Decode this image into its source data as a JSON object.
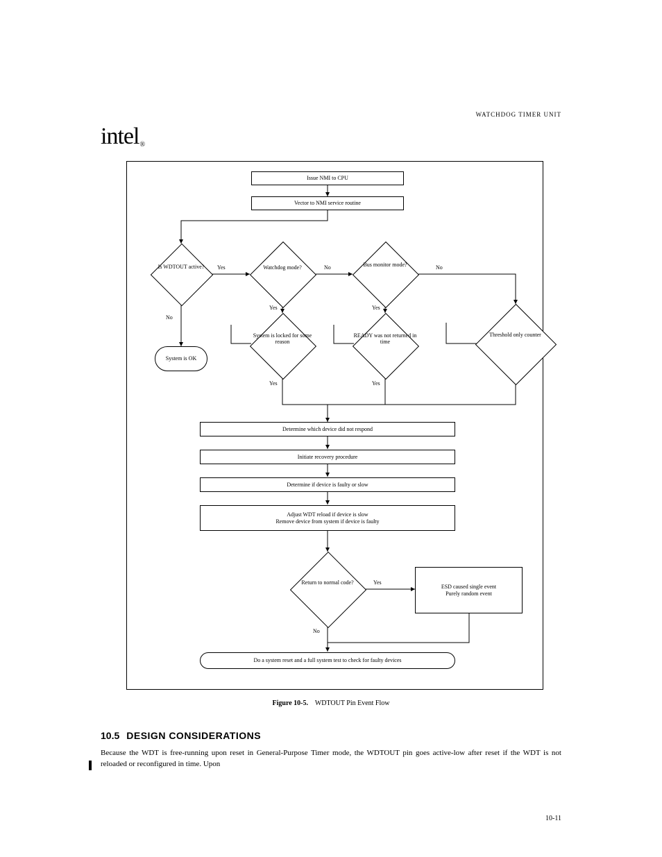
{
  "header": {
    "section_label": "WATCHDOG TIMER UNIT"
  },
  "logo": {
    "text": "intel",
    "reg": "®"
  },
  "flow": {
    "n1": "Issue NMI to CPU",
    "n2": "Vector to NMI service routine",
    "d1": "Is\nWDTOUT\nactive?",
    "d1_no": "No",
    "d1_yes": "Yes",
    "t1": "System\nis OK",
    "d2": "Watchdog\nmode?",
    "d2_yes": "Yes",
    "d2_no": "No",
    "d3": "Bus\nmonitor\nmode?",
    "d3_yes": "Yes",
    "d3_no": "No",
    "d4": "System is\nlocked for some\nreason",
    "d4_yes": "Yes",
    "d5": "READY\nwas not returned\nin time",
    "d5_yes": "Yes",
    "d6": "Threshold\nonly\ncounter",
    "n3": "Determine which device did not respond",
    "n4": "Initiate recovery procedure",
    "n5": "Determine if device is faulty or slow",
    "n6": "Adjust WDT reload if device is slow\nRemove device from system if device is faulty",
    "d7": "Return\nto normal\ncode?",
    "d7_yes": "Yes",
    "d7_no": "No",
    "n7": "ESD caused single event\nPurely random event",
    "term": "Do a system reset and a full system test to check for faulty devices"
  },
  "caption": {
    "label": "Figure 10-5.",
    "text": "WDTOUT Pin Event Flow"
  },
  "section": {
    "number": "10.5",
    "title": "DESIGN CONSIDERATIONS",
    "body": "Because the WDT is free-running upon reset in General-Purpose Timer mode, the WDTOUT pin goes active-low after reset if the WDT is not reloaded or reconfigured in time. Upon"
  },
  "page_number": "10-11"
}
